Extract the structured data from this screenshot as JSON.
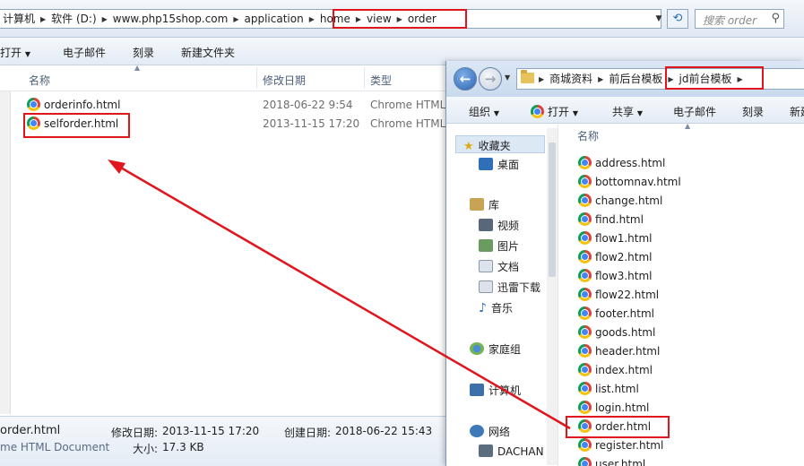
{
  "back_window": {
    "breadcrumb": [
      "计算机",
      "软件 (D:)",
      "www.php15shop.com",
      "application",
      "home",
      "view",
      "order"
    ],
    "search_placeholder": "搜索 order",
    "toolbar": {
      "open": "打开",
      "email": "电子邮件",
      "burn": "刻录",
      "new_folder": "新建文件夹"
    },
    "columns": {
      "name": "名称",
      "modified": "修改日期",
      "type": "类型"
    },
    "files": [
      {
        "name": "orderinfo.html",
        "modified": "2018-06-22 9:54",
        "type": "Chrome HTML"
      },
      {
        "name": "selforder.html",
        "modified": "2013-11-15 17:20",
        "type": "Chrome HTML"
      }
    ],
    "status": {
      "filename": "order.html",
      "filetype": "me HTML Document",
      "modified_label": "修改日期:",
      "modified_value": "2013-11-15 17:20",
      "created_label": "创建日期:",
      "created_value": "2018-06-22 15:43",
      "size_label": "大小:",
      "size_value": "17.3 KB"
    }
  },
  "front_window": {
    "breadcrumb": [
      "商城资料",
      "前后台模板",
      "jd前台模板"
    ],
    "toolbar": {
      "organize": "组织",
      "open": "打开",
      "share": "共享",
      "email": "电子邮件",
      "burn": "刻录",
      "new": "新建"
    },
    "nav": {
      "favorites": "收藏夹",
      "desktop": "桌面",
      "libraries": "库",
      "videos": "视频",
      "pictures": "图片",
      "documents": "文档",
      "thunder": "迅雷下载",
      "music": "音乐",
      "homegroup": "家庭组",
      "computer": "计算机",
      "network": "网络",
      "dachan": "DACHAN"
    },
    "column_name": "名称",
    "files": [
      "address.html",
      "bottomnav.html",
      "change.html",
      "find.html",
      "flow1.html",
      "flow2.html",
      "flow3.html",
      "flow22.html",
      "footer.html",
      "goods.html",
      "header.html",
      "index.html",
      "list.html",
      "login.html",
      "order.html",
      "register.html",
      "user.html"
    ]
  },
  "colors": {
    "highlight": "#e0161e",
    "accent": "#2a6ebb"
  },
  "icons": [
    "chrome-icon",
    "folder-icon",
    "refresh-icon",
    "search-icon",
    "back-icon",
    "forward-icon"
  ]
}
